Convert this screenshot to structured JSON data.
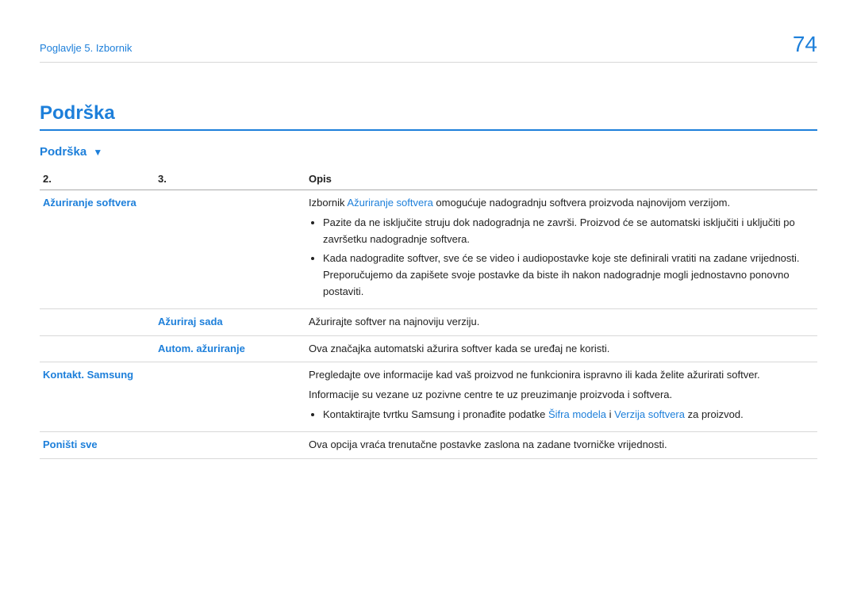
{
  "header": {
    "chapter": "Poglavlje 5. Izbornik",
    "page_number": "74"
  },
  "section": {
    "title": "Podrška",
    "subsection": "Podrška",
    "triangle": "▼"
  },
  "table": {
    "head": {
      "c2": "2.",
      "c3": "3.",
      "desc": "Opis"
    },
    "rows": {
      "r1": {
        "c2": "Ažuriranje softvera",
        "c3": "",
        "intro_pre": "Izbornik ",
        "intro_blue": "Ažuriranje softvera",
        "intro_post": " omogućuje nadogradnju softvera proizvoda najnovijom verzijom.",
        "b1": "Pazite da ne isključite struju dok nadogradnja ne završi. Proizvod će se automatski isključiti i uključiti po završetku nadogradnje softvera.",
        "b2": "Kada nadogradite softver, sve će se video i audiopostavke koje ste definirali vratiti na zadane vrijednosti. Preporučujemo da zapišete svoje postavke da biste ih nakon nadogradnje mogli jednostavno ponovno postaviti."
      },
      "r2": {
        "c2": "",
        "c3": "Ažuriraj sada",
        "desc": "Ažurirajte softver na najnoviju verziju."
      },
      "r3": {
        "c2": "",
        "c3": "Autom. ažuriranje",
        "desc": "Ova značajka automatski ažurira softver kada se uređaj ne koristi."
      },
      "r4": {
        "c2": "Kontakt. Samsung",
        "c3": "",
        "p1": "Pregledajte ove informacije kad vaš proizvod ne funkcionira ispravno ili kada želite ažurirati softver.",
        "p2": "Informacije su vezane uz pozivne centre te uz preuzimanje proizvoda i softvera.",
        "b1_pre": "Kontaktirajte tvrtku Samsung i pronađite podatke ",
        "b1_blue1": "Šifra modela",
        "b1_mid": " i ",
        "b1_blue2": "Verzija softvera",
        "b1_post": " za proizvod."
      },
      "r5": {
        "c2": "Poništi sve",
        "c3": "",
        "desc": "Ova opcija vraća trenutačne postavke zaslona na zadane tvorničke vrijednosti."
      }
    }
  }
}
